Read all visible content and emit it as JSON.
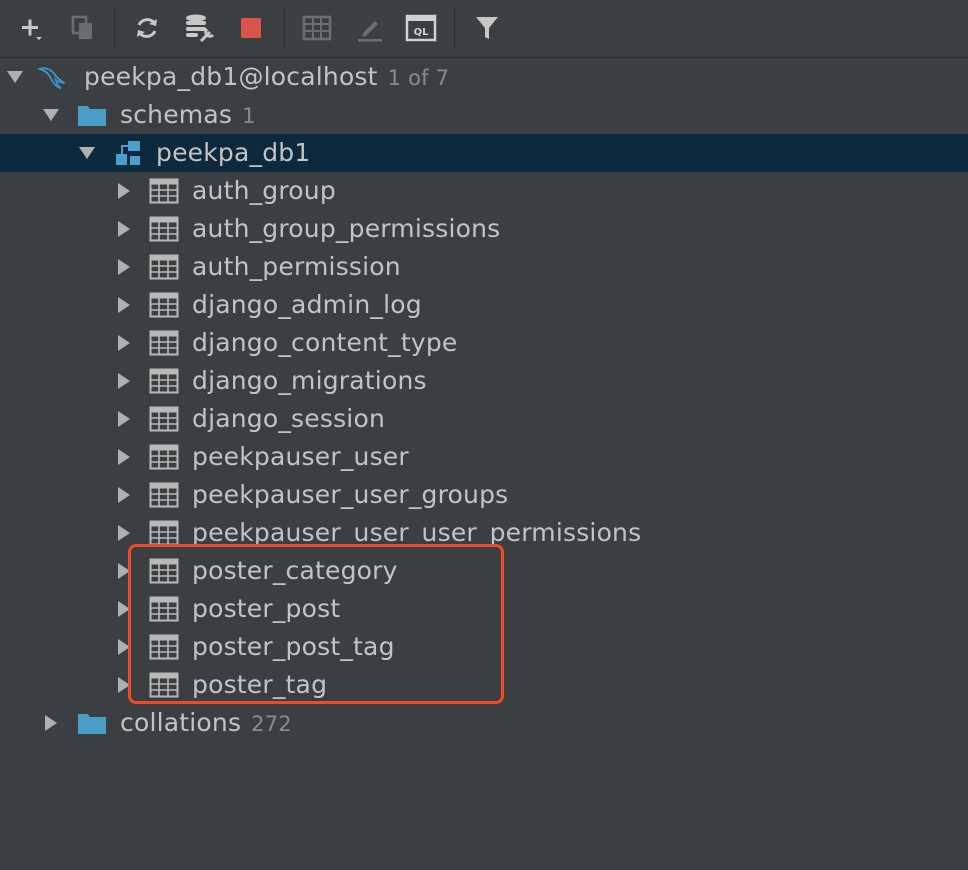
{
  "toolbar": {
    "buttons": [
      {
        "name": "add-button",
        "icon": "plus-icon"
      },
      {
        "name": "copy-button",
        "icon": "copy-icon"
      },
      {
        "name": "refresh-button",
        "icon": "refresh-icon"
      },
      {
        "name": "db-properties-button",
        "icon": "database-wrench-icon"
      },
      {
        "name": "stop-button",
        "icon": "stop-icon"
      },
      {
        "name": "table-view-button",
        "icon": "table-icon"
      },
      {
        "name": "edit-button",
        "icon": "pencil-icon"
      },
      {
        "name": "query-console-button",
        "icon": "ql-icon",
        "text": "QL"
      },
      {
        "name": "filter-button",
        "icon": "filter-icon"
      }
    ]
  },
  "tree": {
    "connection": {
      "label": "peekpa_db1@localhost",
      "count": "1 of 7"
    },
    "schemas": {
      "label": "schemas",
      "count": "1"
    },
    "schema": {
      "label": "peekpa_db1"
    },
    "tables": [
      "auth_group",
      "auth_group_permissions",
      "auth_permission",
      "django_admin_log",
      "django_content_type",
      "django_migrations",
      "django_session",
      "peekpauser_user",
      "peekpauser_user_groups",
      "peekpauser_user_user_permissions",
      "poster_category",
      "poster_post",
      "poster_post_tag",
      "poster_tag"
    ],
    "collations": {
      "label": "collations",
      "count": "272"
    }
  },
  "colors": {
    "background": "#3c3f41",
    "selected_row": "#0d293e",
    "folder": "#4a9ec7",
    "highlight": "#ee4b2b",
    "stop": "#d9534f"
  }
}
